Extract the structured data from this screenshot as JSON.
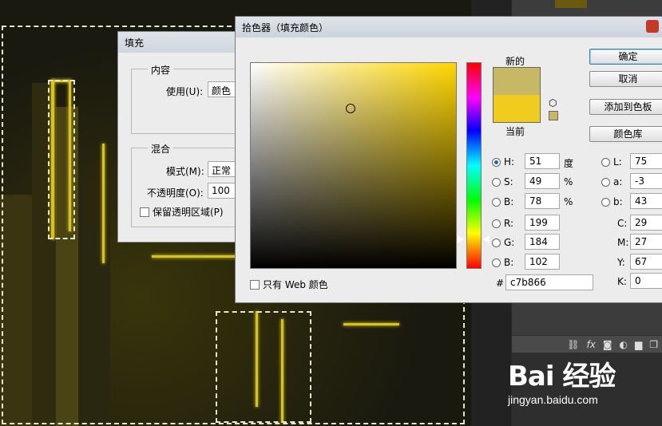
{
  "fill_dialog": {
    "title": "填充",
    "content_group": "内容",
    "use_label": "使用(U):",
    "use_value": "颜色",
    "blend_group": "混合",
    "mode_label": "模式(M):",
    "mode_value": "正常",
    "opacity_label": "不透明度(O):",
    "opacity_value": "100",
    "preserve_label": "保留透明区域(P)"
  },
  "picker": {
    "title": "拾色器（填充颜色）",
    "new_label": "新的",
    "current_label": "当前",
    "new_color": "#c7b866",
    "current_color": "#f0cc1e",
    "ok_label": "确定",
    "cancel_label": "取消",
    "add_swatch_label": "添加到色板",
    "color_library_label": "颜色库",
    "web_only_label": "只有 Web 颜色",
    "hex_label": "#",
    "hex_value": "c7b866",
    "fields": {
      "H": {
        "label": "H:",
        "value": "51",
        "unit": "度"
      },
      "S": {
        "label": "S:",
        "value": "49",
        "unit": "%"
      },
      "Bv": {
        "label": "B:",
        "value": "78",
        "unit": "%"
      },
      "R": {
        "label": "R:",
        "value": "199"
      },
      "G": {
        "label": "G:",
        "value": "184"
      },
      "B": {
        "label": "B:",
        "value": "102"
      },
      "L": {
        "label": "L:",
        "value": "75"
      },
      "a": {
        "label": "a:",
        "value": "-3"
      },
      "b": {
        "label": "b:",
        "value": "43"
      },
      "C": {
        "label": "C:",
        "value": "29",
        "unit": "%"
      },
      "M": {
        "label": "M:",
        "value": "27",
        "unit": "%"
      },
      "Y": {
        "label": "Y:",
        "value": "67",
        "unit": "%"
      },
      "K": {
        "label": "K:",
        "value": "0",
        "unit": "%"
      }
    }
  },
  "layers_panel": {
    "icons": [
      "link-icon",
      "fx-icon",
      "mask-icon",
      "adjustment-icon",
      "folder-icon",
      "new-layer-icon"
    ]
  },
  "watermark": {
    "logo": "Bai 经验",
    "url": "jingyan.baidu.com"
  }
}
